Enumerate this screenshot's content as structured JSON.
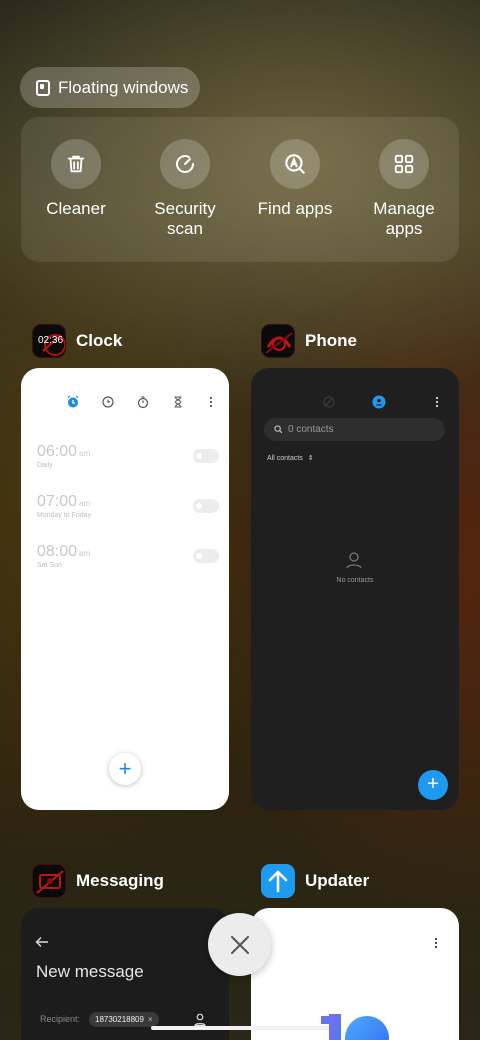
{
  "floating_windows": {
    "label": "Floating windows",
    "icon": "floating-window-icon"
  },
  "tools": [
    {
      "id": "cleaner",
      "icon": "trash-icon",
      "label_lines": [
        "Cleaner"
      ]
    },
    {
      "id": "security",
      "icon": "security-scan-icon",
      "label_lines": [
        "Security",
        "scan"
      ]
    },
    {
      "id": "findapps",
      "icon": "find-apps-icon",
      "label_lines": [
        "Find apps"
      ]
    },
    {
      "id": "manage",
      "icon": "grid-icon",
      "label_lines": [
        "Manage",
        "apps"
      ]
    }
  ],
  "apps": {
    "clock": {
      "name": "Clock",
      "icon_time": "02:36",
      "alarms": [
        {
          "time": "06:00",
          "ampm": "am",
          "repeat": "Daily"
        },
        {
          "time": "07:00",
          "ampm": "am",
          "repeat": "Monday to Friday"
        },
        {
          "time": "08:00",
          "ampm": "am",
          "repeat": "Sat Sun"
        }
      ],
      "fab": "+"
    },
    "phone": {
      "name": "Phone",
      "search_placeholder": "0 contacts",
      "filter": "All contacts",
      "empty": "No contacts",
      "fab": "+"
    },
    "messaging": {
      "name": "Messaging",
      "title": "New message",
      "recipient_label": "Recipient:",
      "recipient_chip": "18730218809"
    },
    "updater": {
      "name": "Updater"
    }
  },
  "colors": {
    "accent_blue": "#1e9bf0",
    "clock_accent": "#1e88e5"
  }
}
